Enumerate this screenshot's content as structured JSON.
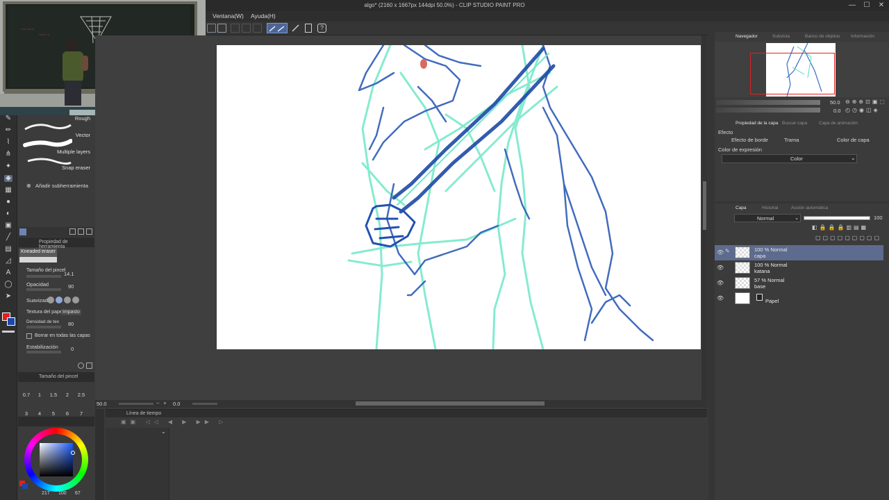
{
  "window": {
    "title": "algo* (2160 x 1667px 144dpi 50.0%) - CLIP STUDIO PAINT PRO",
    "minimize": "—",
    "maximize": "☐",
    "close": "✕"
  },
  "menu": [
    "Ventana(W)",
    "Ayuda(H)"
  ],
  "subtools": [
    {
      "label": "Rough"
    },
    {
      "label": "Vector"
    },
    {
      "label": "Multiple layers"
    },
    {
      "label": "Snap eraser"
    }
  ],
  "add_subtool": "Añadir subherramienta",
  "tool_property": {
    "header": "Propiedad de herramienta",
    "tool_name": "Kneaded eraser",
    "brush_size_label": "Tamaño del pincel",
    "brush_size_value": "14.1",
    "opacity_label": "Opacidad",
    "opacity_value": "90",
    "smoothing_label": "Suavizado",
    "paper_texture_label": "Textura del papel",
    "paper_texture_value": "Impasto",
    "texture_density_label": "Densidad de tex",
    "texture_density_value": "80",
    "all_layers_label": "Borrar en todas las capas",
    "stabilization_label": "Estabilización",
    "stabilization_value": "0"
  },
  "brush_size_panel": {
    "header": "Tamaño del pincel",
    "sizes": [
      "0.7",
      "1",
      "1.5",
      "2",
      "2.5"
    ],
    "sizes_row2": [
      "3",
      "4",
      "5",
      "6",
      "7"
    ]
  },
  "color_status": {
    "h": "217",
    "s": "100",
    "v": "67"
  },
  "canvas_status": {
    "zoom": "50.0",
    "angle": "0.0"
  },
  "timeline": {
    "header": "Línea de tiempo"
  },
  "navigator": {
    "tabs": [
      "Navegador",
      "Subvista",
      "Banco de objetos",
      "Información"
    ],
    "zoom": "50.0",
    "angle": "0.0"
  },
  "layer_property": {
    "tabs": [
      "Propiedad de la capa",
      "Buscar capa",
      "Capa de animación"
    ],
    "effect_label": "Efecto",
    "effects": [
      "Efecto de borde",
      "Trama",
      "Color de capa"
    ],
    "expression_color_label": "Color de expresión",
    "expression_color_value": "Color"
  },
  "layer_panel": {
    "tabs": [
      "Capa",
      "Historial",
      "Acción automática"
    ],
    "blend_mode": "Normal",
    "opacity": "100",
    "layers": [
      {
        "line1": "100 % Normal",
        "line2": "capa",
        "selected": true
      },
      {
        "line1": "100 % Normal",
        "line2": "katana",
        "selected": false
      },
      {
        "line1": "57 % Normal",
        "line2": "base",
        "selected": false
      },
      {
        "line1": "",
        "line2": "Papel",
        "selected": false
      }
    ]
  },
  "colors": {
    "main_color": "#e02020",
    "sub_color": "#1a4aa8",
    "selected_layer": "#5d6b8e",
    "sketch_blue": "#2d5bb8",
    "sketch_cyan": "#6fe8c8"
  }
}
